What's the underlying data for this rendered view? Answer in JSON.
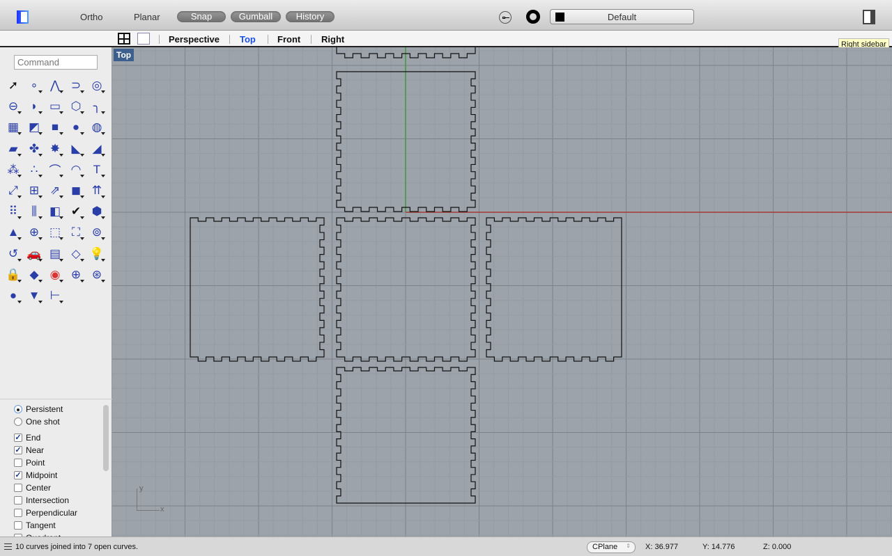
{
  "toolbar": {
    "ortho": "Ortho",
    "planar": "Planar",
    "snap": "Snap",
    "gumball": "Gumball",
    "history": "History",
    "layer": "Default",
    "left_sidebar_icon": "left-sidebar-toggle-icon",
    "right_sidebar_icon": "right-sidebar-toggle-icon"
  },
  "tooltip": "Right sidebar",
  "viewport_tabs": [
    "Perspective",
    "Top",
    "Front",
    "Right"
  ],
  "active_tab": "Top",
  "accent": "#1a4fe0",
  "viewport": {
    "label": "Top",
    "axis_x": "x",
    "axis_y": "y",
    "x_axis_color": "#a33a32",
    "y_axis_color": "#3a9a3a"
  },
  "command": {
    "placeholder": "Command"
  },
  "tools": [
    "select-arrow",
    "point",
    "polyline",
    "curve",
    "circle",
    "ellipse",
    "arc",
    "rectangle",
    "polygon",
    "fillet",
    "surface",
    "sweep",
    "box",
    "boolean-solids",
    "cylinder",
    "surface-patch",
    "explode-join",
    "extrude-solid",
    "split",
    "trim",
    "point-display",
    "control-points",
    "curve-tools",
    "curve-offset",
    "text",
    "transform-move",
    "group",
    "array-rotate",
    "solid-edit",
    "project",
    "array",
    "split-pipe",
    "analyze",
    "check",
    "mesh",
    "light-pyramid",
    "zoom",
    "zoom-window",
    "zoom-extents",
    "zoom-selected",
    "rotate-view",
    "car-render",
    "grid",
    "named-shapes",
    "light-bulb",
    "lock",
    "layer-material",
    "color-wheel",
    "shaded-sphere",
    "grid-sphere",
    "render-sphere",
    "spotlight",
    "dimension"
  ],
  "snaps": {
    "mode": [
      {
        "label": "Persistent",
        "selected": true
      },
      {
        "label": "One shot",
        "selected": false
      }
    ],
    "items": [
      {
        "label": "End",
        "checked": true
      },
      {
        "label": "Near",
        "checked": true
      },
      {
        "label": "Point",
        "checked": false
      },
      {
        "label": "Midpoint",
        "checked": true
      },
      {
        "label": "Center",
        "checked": false
      },
      {
        "label": "Intersection",
        "checked": false
      },
      {
        "label": "Perpendicular",
        "checked": false
      },
      {
        "label": "Tangent",
        "checked": false
      },
      {
        "label": "Quadrant",
        "checked": false
      }
    ]
  },
  "status": {
    "message": "10 curves joined into 7 open curves.",
    "cplane": "CPlane",
    "x": "X: 36.977",
    "y": "Y: 14.776",
    "z": "Z: 0.000"
  }
}
